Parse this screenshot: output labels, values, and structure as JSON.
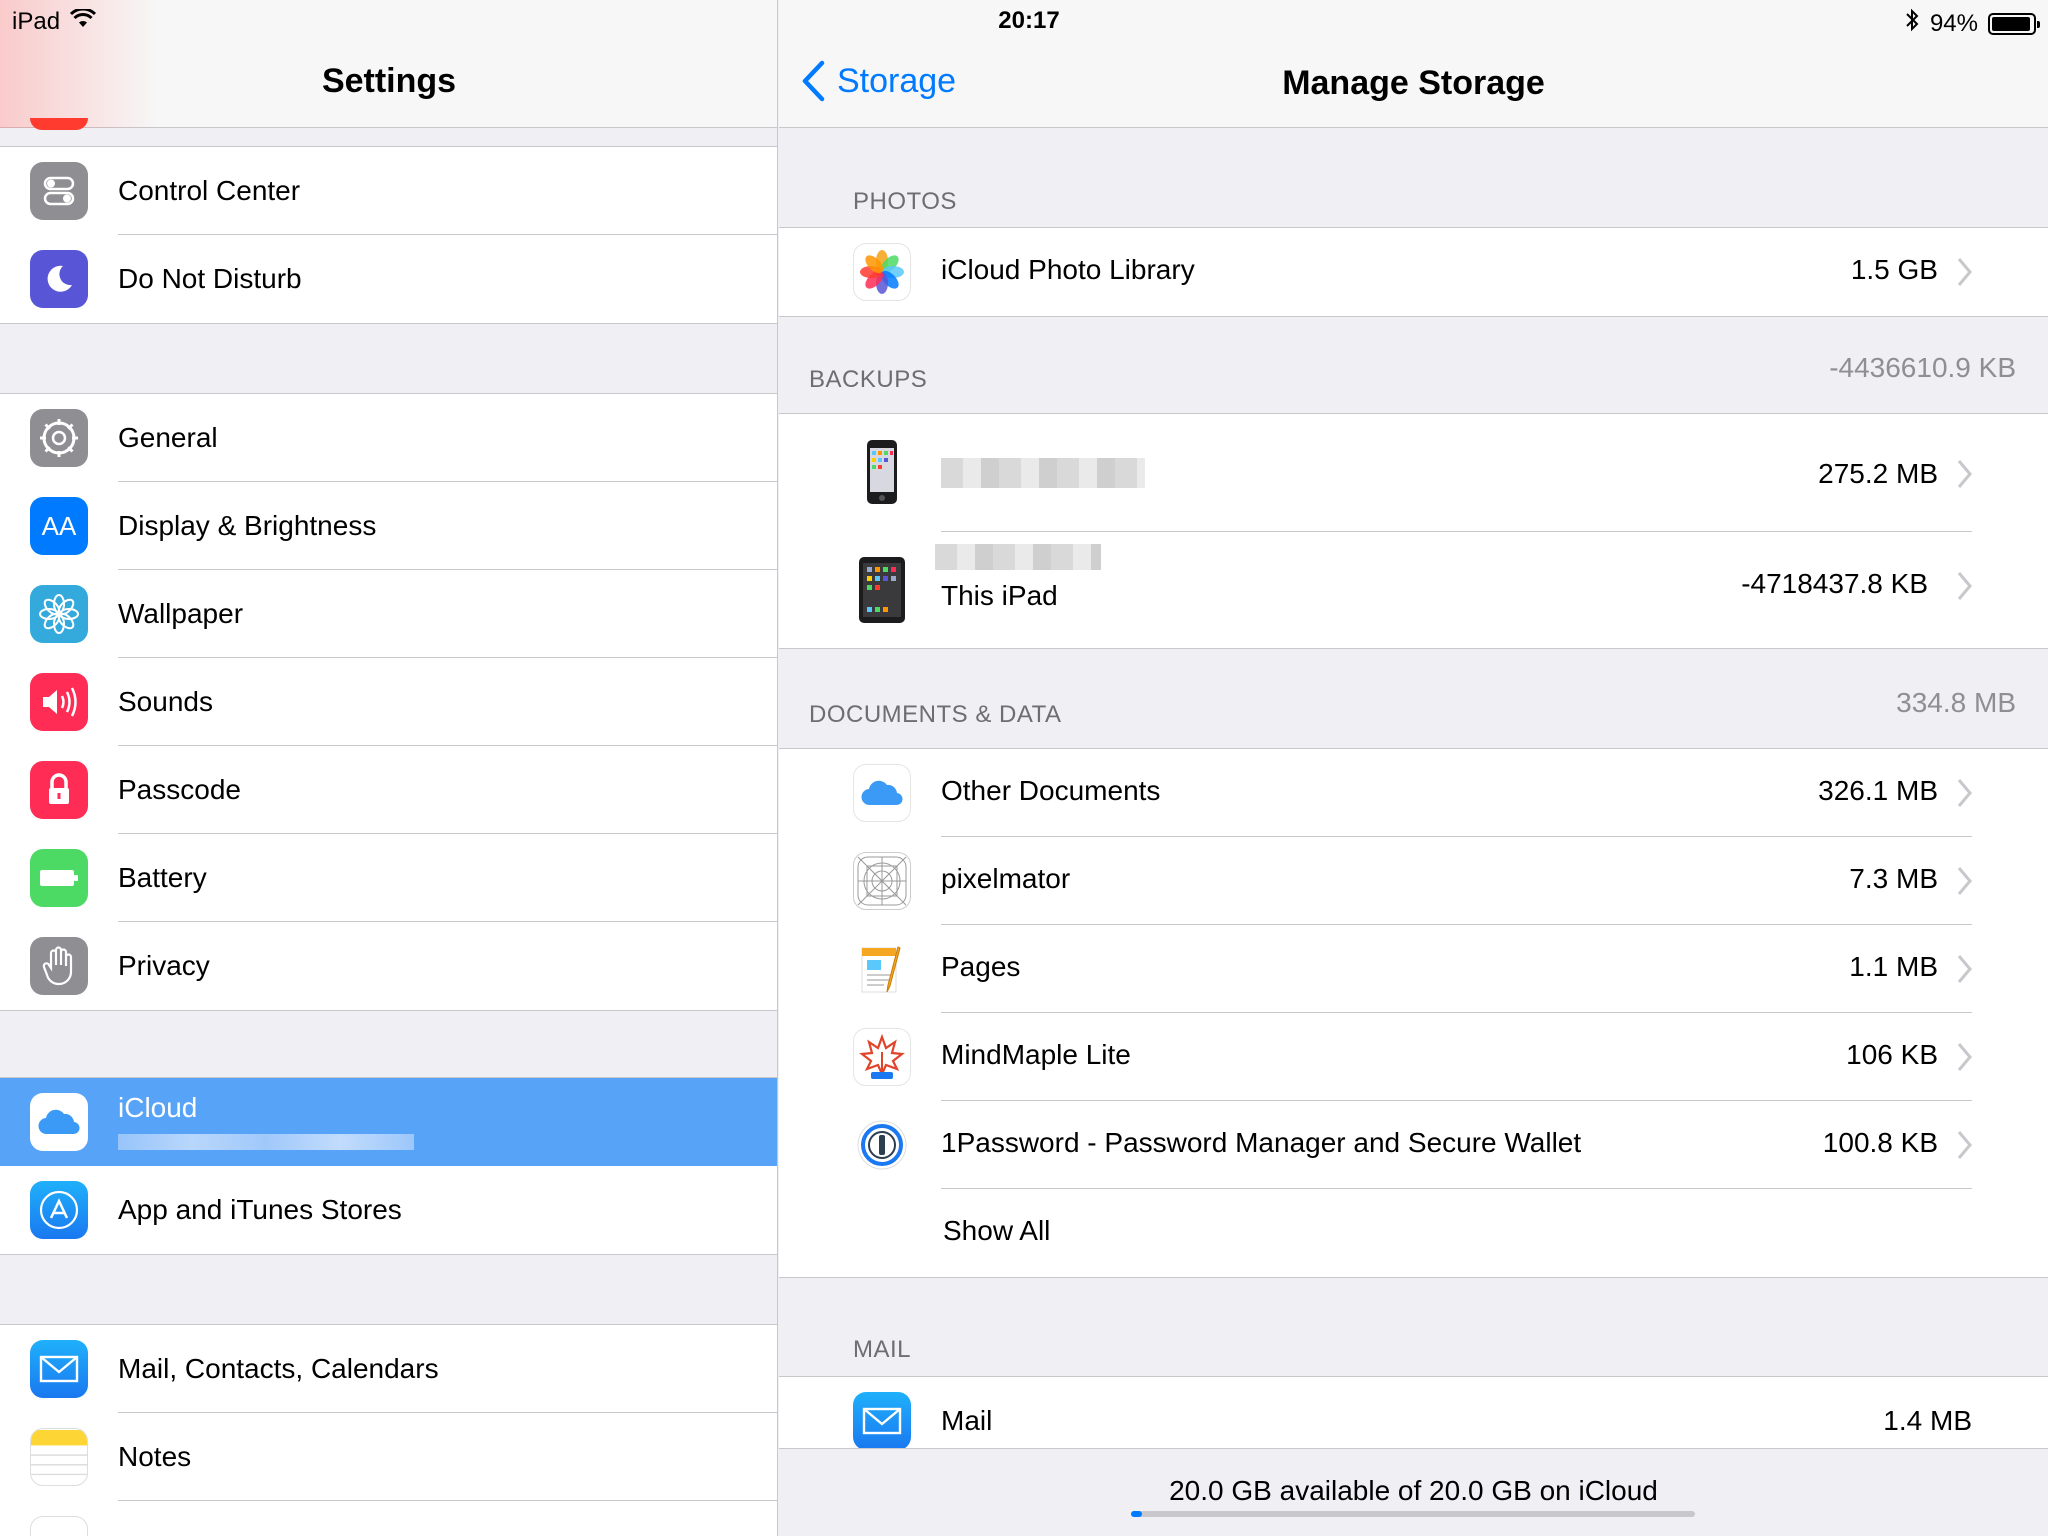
{
  "status_bar": {
    "device": "iPad",
    "time": "20:17",
    "battery_percent": "94%",
    "battery_level": 0.94,
    "icons": [
      "wifi-icon",
      "bluetooth-icon",
      "battery-icon"
    ]
  },
  "sidebar": {
    "title": "Settings",
    "items": [
      {
        "label": "Control Center",
        "icon": "control-center-icon",
        "color": "#8e8e93"
      },
      {
        "label": "Do Not Disturb",
        "icon": "moon-icon",
        "color": "#5856d6"
      },
      {
        "label": "General",
        "icon": "gear-icon",
        "color": "#8e8e93"
      },
      {
        "label": "Display & Brightness",
        "icon": "text-size-icon",
        "glyph": "AA",
        "color": "#007aff"
      },
      {
        "label": "Wallpaper",
        "icon": "flower-icon",
        "color": "#34aadc"
      },
      {
        "label": "Sounds",
        "icon": "speaker-icon",
        "color": "#ff2d55"
      },
      {
        "label": "Passcode",
        "icon": "lock-icon",
        "color": "#ff2d55"
      },
      {
        "label": "Battery",
        "icon": "battery-icon",
        "color": "#4cd964"
      },
      {
        "label": "Privacy",
        "icon": "hand-icon",
        "color": "#8e8e93"
      },
      {
        "label": "iCloud",
        "icon": "icloud-icon",
        "color": "#ffffff"
      },
      {
        "label": "App and iTunes Stores",
        "icon": "app-store-icon",
        "color": "#1a8cf0"
      },
      {
        "label": "Mail, Contacts, Calendars",
        "icon": "mail-icon",
        "color": "#1a8cf0"
      },
      {
        "label": "Notes",
        "icon": "notes-icon",
        "color": "#ffffff"
      }
    ]
  },
  "main": {
    "back_label": "Storage",
    "title": "Manage Storage",
    "sections": {
      "photos": {
        "header": "PHOTOS",
        "items": [
          {
            "label": "iCloud Photo Library",
            "value": "1.5 GB",
            "icon": "photos-icon"
          }
        ]
      },
      "backups": {
        "header": "BACKUPS",
        "total": "-4436610.9 KB",
        "items": [
          {
            "label": "",
            "value": "275.2 MB",
            "icon": "iphone-icon"
          },
          {
            "label": "This iPad",
            "value": "-4718437.8 KB",
            "icon": "ipad-icon"
          }
        ]
      },
      "documents": {
        "header": "DOCUMENTS & DATA",
        "total": "334.8 MB",
        "items": [
          {
            "label": "Other Documents",
            "value": "326.1 MB",
            "icon": "icloud-drive-icon"
          },
          {
            "label": "pixelmator",
            "value": "7.3 MB",
            "icon": "pixelmator-icon"
          },
          {
            "label": "Pages",
            "value": "1.1 MB",
            "icon": "pages-icon"
          },
          {
            "label": "MindMaple Lite",
            "value": "106 KB",
            "icon": "mindmaple-icon"
          },
          {
            "label": "1Password - Password Manager and Secure Wallet",
            "value": "100.8 KB",
            "icon": "onepassword-icon"
          }
        ],
        "show_all": "Show All"
      },
      "mail": {
        "header": "MAIL",
        "items": [
          {
            "label": "Mail",
            "value": "1.4 MB",
            "icon": "mail-icon"
          }
        ]
      }
    },
    "footer": {
      "text": "20.0 GB available of 20.0 GB on iCloud",
      "used_fraction": 0.02
    },
    "colors": {
      "accent": "#007aff",
      "selected": "#56a3f7"
    }
  }
}
